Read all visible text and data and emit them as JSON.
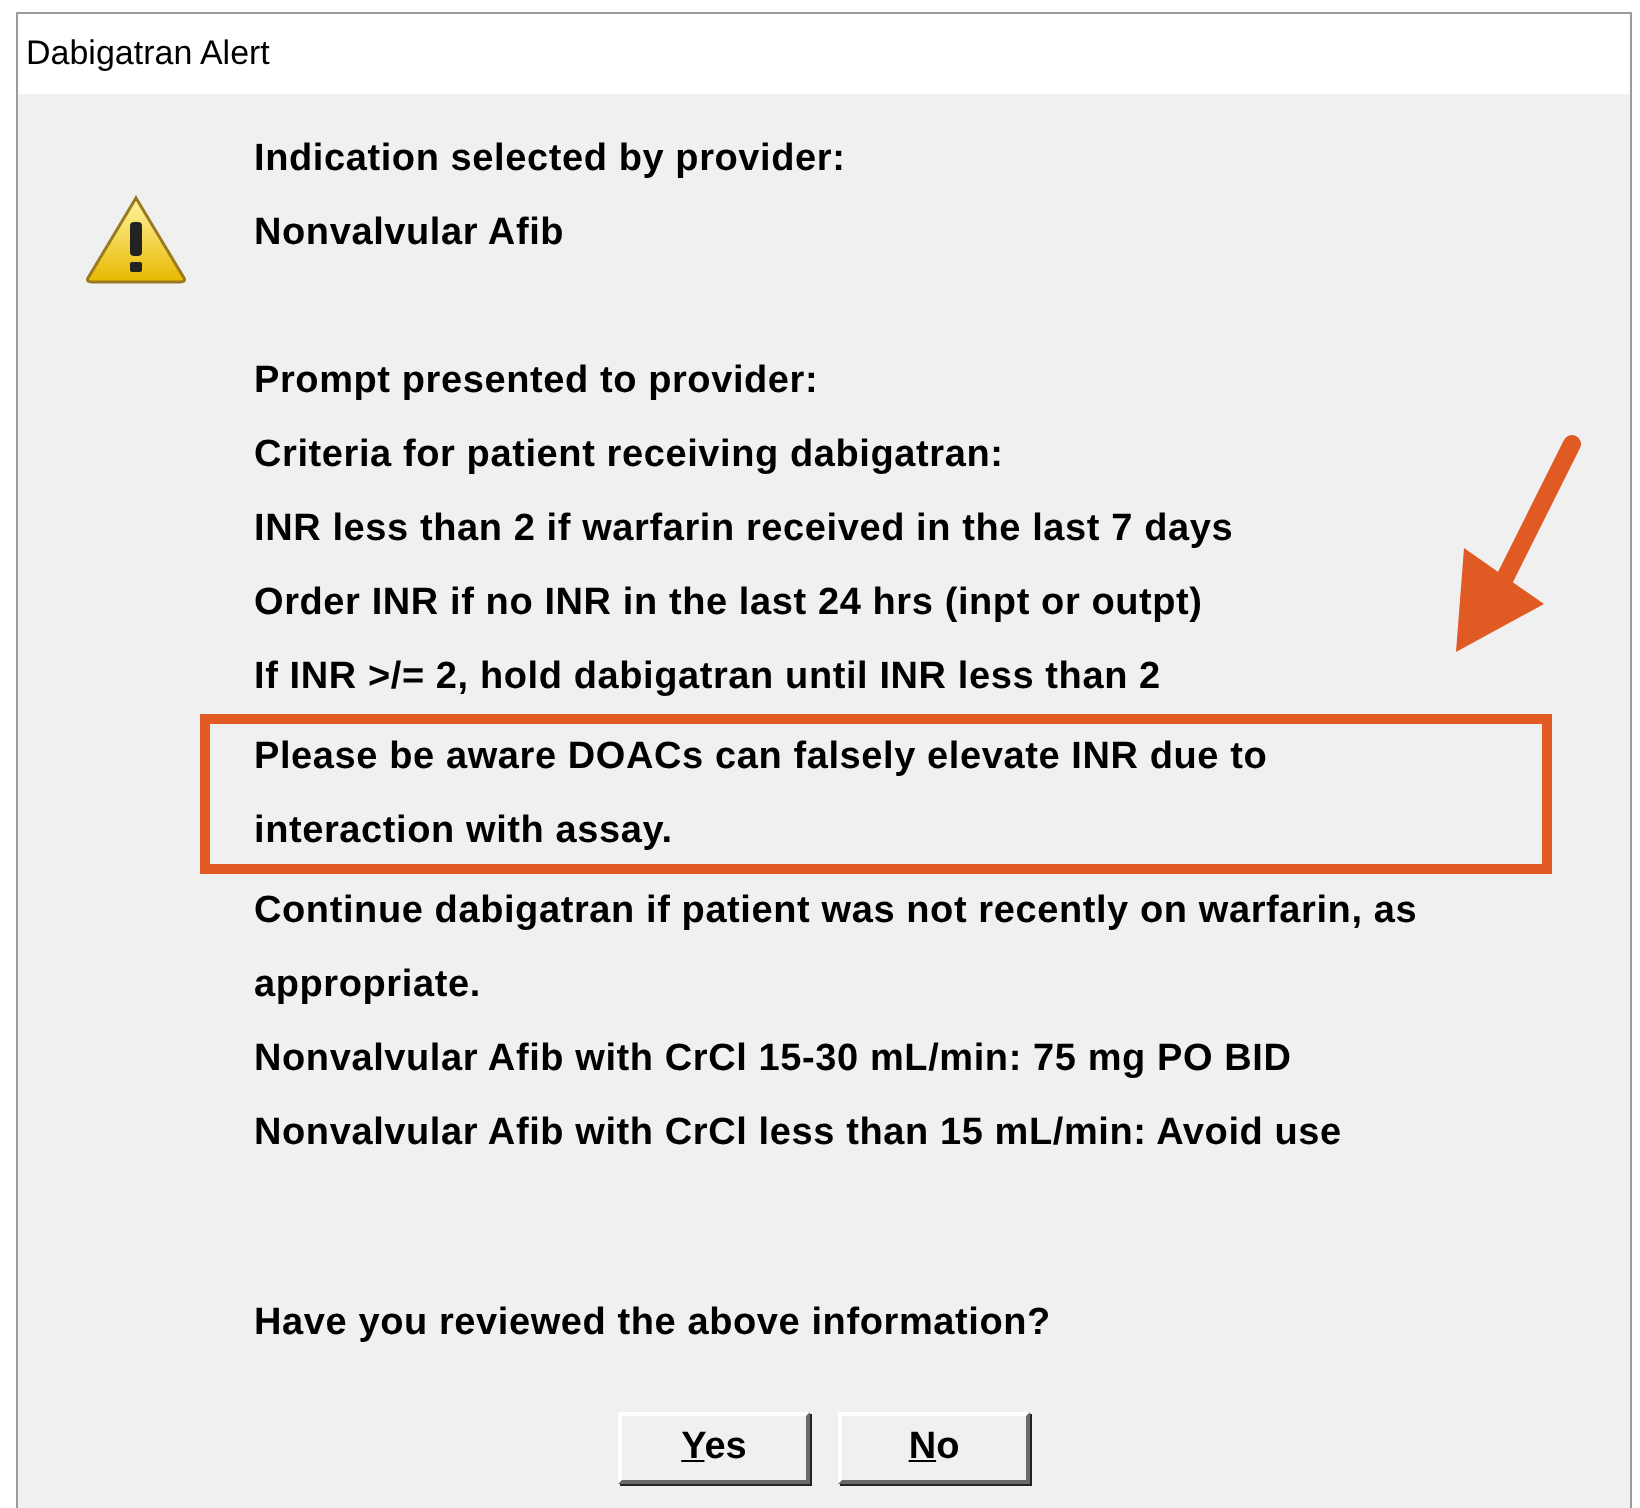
{
  "window": {
    "title": "Dabigatran Alert"
  },
  "indication": [
    "Indication selected by provider:",
    "Nonvalvular Afib"
  ],
  "prompt": [
    {
      "text": "Prompt presented to provider:",
      "highlighted": false
    },
    {
      "text": "Criteria for patient receiving dabigatran:",
      "highlighted": false
    },
    {
      "text": "INR less than 2 if warfarin received in the last 7 days",
      "highlighted": false
    },
    {
      "text": "Order INR if no INR in the last 24 hrs (inpt or outpt)",
      "highlighted": false
    },
    {
      "text": "If INR >/= 2, hold dabigatran until INR less than 2",
      "highlighted": false
    },
    {
      "text": "Please be aware DOACs can falsely elevate INR due to interaction with assay.",
      "highlighted": true
    },
    {
      "text": "Continue dabigatran if patient was not recently on warfarin, as appropriate.",
      "highlighted": false
    },
    {
      "text": "Nonvalvular Afib with CrCl 15-30 mL/min: 75 mg PO BID",
      "highlighted": false
    },
    {
      "text": "Nonvalvular Afib with CrCl less than 15 mL/min: Avoid use",
      "highlighted": false
    }
  ],
  "question": "Have you reviewed the above information?",
  "buttons": [
    {
      "label": "Yes",
      "underline_first": true
    },
    {
      "label": "No",
      "underline_first": true
    }
  ]
}
